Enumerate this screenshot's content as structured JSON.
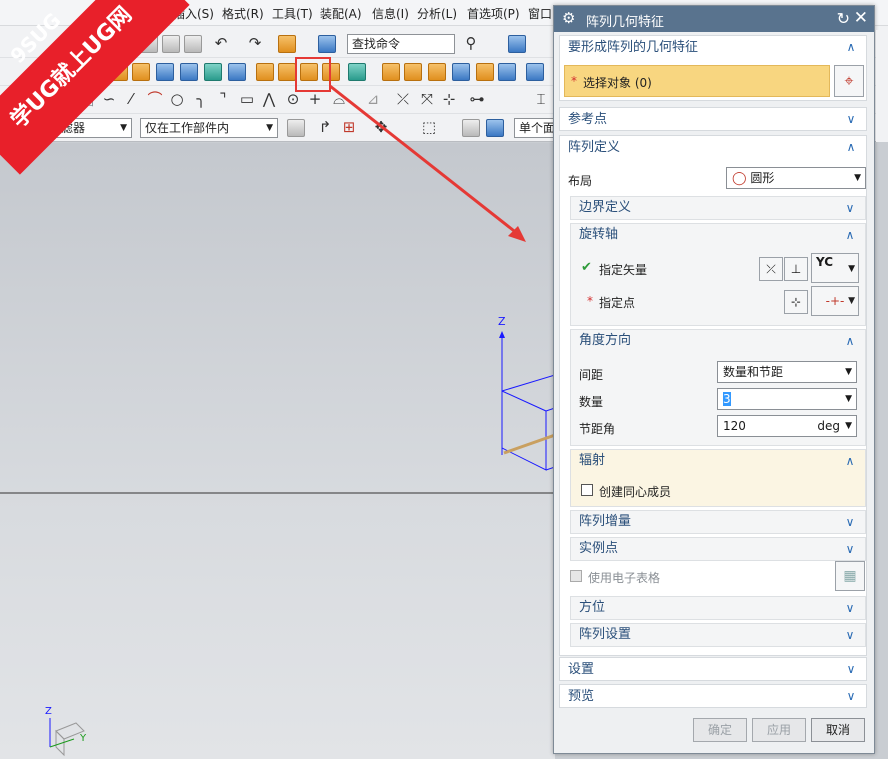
{
  "menubar": {
    "items": [
      "V)",
      "插入(S)",
      "格式(R)",
      "工具(T)",
      "装配(A)",
      "信息(I)",
      "分析(L)",
      "首选项(P)",
      "窗口("
    ]
  },
  "toolbar": {
    "find_command": "查找命令",
    "sketch_label": "成草图",
    "type_filter": "选择过滤器",
    "scope_filter": "仅在工作部件内",
    "single_face": "单个面"
  },
  "watermark": {
    "line1": "9SUG",
    "line2": "学UG就上UG网"
  },
  "viewport": {
    "axis_z": "Z",
    "triad_z": "Z",
    "triad_y": "Y"
  },
  "dialog": {
    "title": "阵列几何特征",
    "sections": {
      "geometry": {
        "title": "要形成阵列的几何特征",
        "select_label": "选择对象 (0)"
      },
      "ref_point": {
        "title": "参考点"
      },
      "array_def": {
        "title": "阵列定义",
        "layout_label": "布局",
        "layout_value": "圆形",
        "boundary": {
          "title": "边界定义"
        },
        "rotation_axis": {
          "title": "旋转轴",
          "vector_label": "指定矢量",
          "vector_value": "YC",
          "point_label": "指定点"
        },
        "angle_dir": {
          "title": "角度方向",
          "spacing_label": "间距",
          "spacing_value": "数量和节距",
          "count_label": "数量",
          "count_value": "3",
          "pitch_label": "节距角",
          "pitch_value": "120",
          "pitch_unit": "deg"
        },
        "radiation": {
          "title": "辐射",
          "checkbox_label": "创建同心成员"
        },
        "increment": {
          "title": "阵列增量"
        },
        "instance_points": {
          "title": "实例点"
        },
        "spreadsheet_label": "使用电子表格",
        "orientation": {
          "title": "方位"
        },
        "array_settings": {
          "title": "阵列设置"
        }
      },
      "settings": {
        "title": "设置"
      },
      "preview": {
        "title": "预览"
      }
    },
    "buttons": {
      "ok": "确定",
      "apply": "应用",
      "cancel": "取消"
    }
  },
  "colors": {
    "title_bar": "#59738e",
    "highlight": "#f8d680",
    "annotation": "#e53935",
    "header_text": "#2a4f7a"
  }
}
